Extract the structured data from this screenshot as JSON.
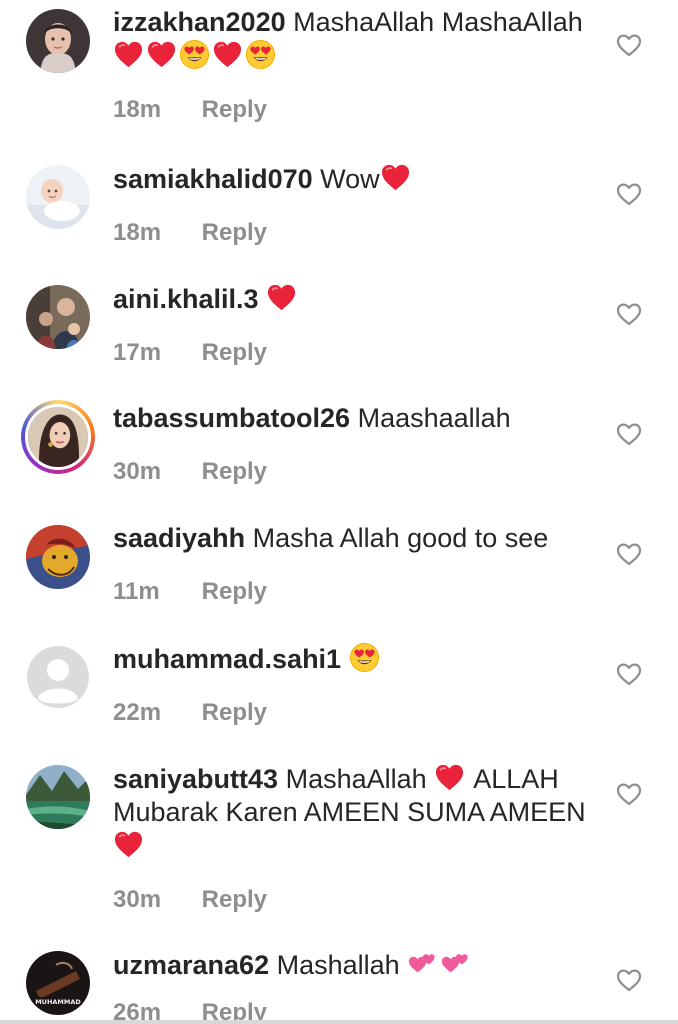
{
  "comments": [
    {
      "username": "izzakhan2020",
      "text": "MashaAllah MashaAllah",
      "time": "18m",
      "reply": "Reply"
    },
    {
      "username": "samiakhalid070",
      "text": "Wow",
      "time": "18m",
      "reply": "Reply"
    },
    {
      "username": "aini.khalil.3",
      "text": "",
      "time": "17m",
      "reply": "Reply"
    },
    {
      "username": "tabassumbatool26",
      "text": "Maashaallah",
      "time": "30m",
      "reply": "Reply"
    },
    {
      "username": "saadiyahh",
      "text": "Masha Allah good to see",
      "time": "11m",
      "reply": "Reply"
    },
    {
      "username": "muhammad.sahi1",
      "text": "",
      "time": "22m",
      "reply": "Reply"
    },
    {
      "username": "saniyabutt43",
      "text": "MashaAllah",
      "text2": "ALLAH Mubarak Karen AMEEN SUMA AMEEN",
      "time": "30m",
      "reply": "Reply"
    },
    {
      "username": "uzmarana62",
      "text": "Mashallah",
      "time": "26m",
      "reply": "Reply"
    }
  ],
  "avatar_badge_text": "MUHAMMAD",
  "colors": {
    "text": "#262626",
    "meta": "#8e8e8e",
    "heart": "#e0245e"
  }
}
